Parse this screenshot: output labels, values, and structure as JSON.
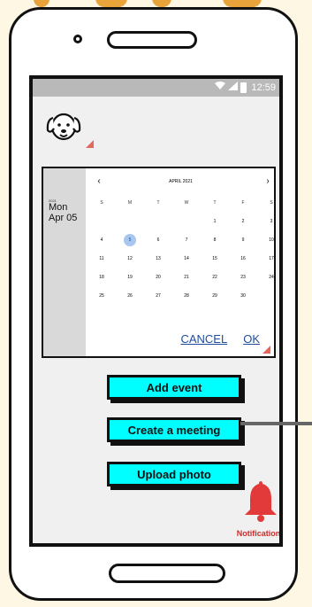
{
  "status_bar": {
    "wifi_icon": "wifi-icon",
    "signal_icon": "signal-icon",
    "battery_icon": "battery-icon",
    "time": "12:59"
  },
  "profile": {
    "avatar_icon": "dog-face-icon"
  },
  "date_picker": {
    "year": "2021",
    "selected_label_line1": "Mon",
    "selected_label_line2": "Apr 05",
    "month_title": "APRIL 2021",
    "prev_icon": "chevron-left-icon",
    "next_icon": "chevron-right-icon",
    "weekday_headers": [
      "S",
      "M",
      "T",
      "W",
      "T",
      "F",
      "S"
    ],
    "weeks": [
      [
        "",
        "",
        "",
        "",
        "1",
        "2",
        "3"
      ],
      [
        "4",
        "5",
        "6",
        "7",
        "8",
        "9",
        "10"
      ],
      [
        "11",
        "12",
        "13",
        "14",
        "15",
        "16",
        "17"
      ],
      [
        "18",
        "19",
        "20",
        "21",
        "22",
        "23",
        "24"
      ],
      [
        "25",
        "26",
        "27",
        "28",
        "29",
        "30",
        ""
      ]
    ],
    "selected_day": "5",
    "cancel_label": "CANCEL",
    "ok_label": "OK"
  },
  "actions": {
    "add_event_label": "Add event",
    "create_meeting_label": "Create a meeting",
    "upload_photo_label": "Upload photo"
  },
  "notifications": {
    "icon": "bell-icon",
    "label": "Notifications",
    "color": "#e23a3a"
  },
  "colors": {
    "button_fill": "#00ffff",
    "link_color": "#1e4da1",
    "selected_day_fill": "#a9c6ef"
  }
}
